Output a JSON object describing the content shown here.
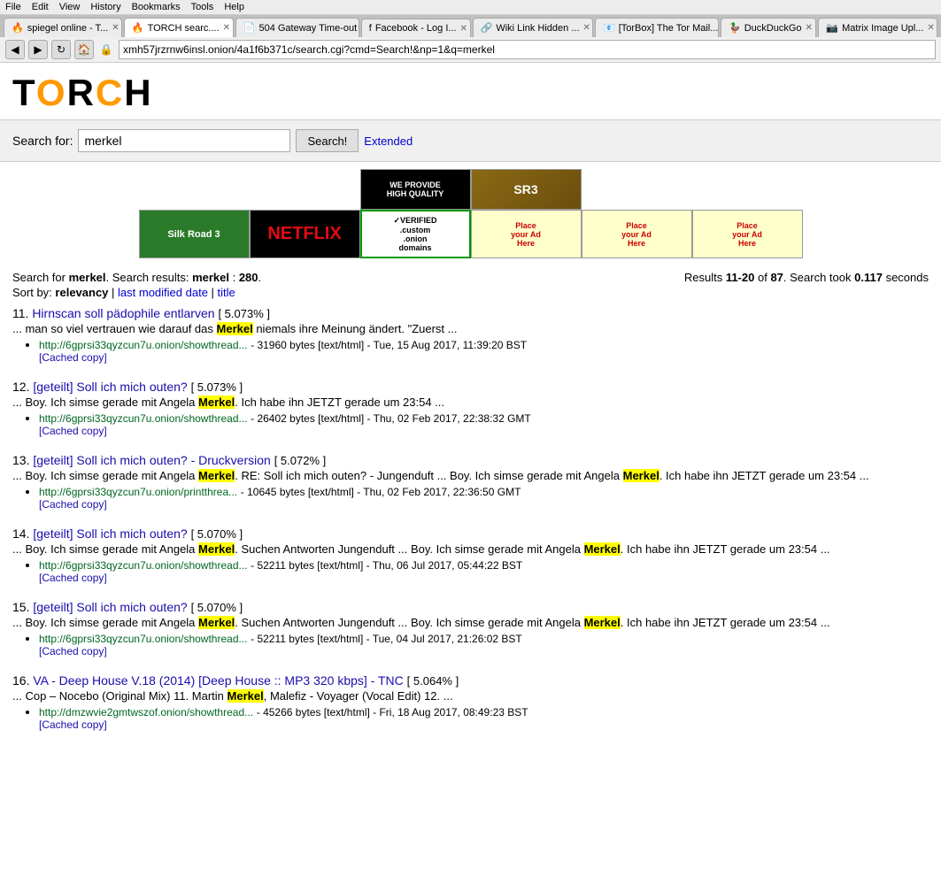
{
  "browser": {
    "menu_items": [
      "File",
      "Edit",
      "View",
      "History",
      "Bookmarks",
      "Tools",
      "Help"
    ],
    "tabs": [
      {
        "label": "spiegel online - T...",
        "active": false,
        "icon": "🔥"
      },
      {
        "label": "TORCH searc....",
        "active": true,
        "icon": "🔥"
      },
      {
        "label": "504 Gateway Time-out",
        "active": false,
        "icon": "📄"
      },
      {
        "label": "Facebook - Log I...",
        "active": false,
        "icon": "f"
      },
      {
        "label": "Wiki Link Hidden ...",
        "active": false,
        "icon": "🔗"
      },
      {
        "label": "[TorBox] The Tor Mail...",
        "active": false,
        "icon": "📧"
      },
      {
        "label": "DuckDuckGo",
        "active": false,
        "icon": "🦆"
      },
      {
        "label": "Matrix Image Upl...",
        "active": false,
        "icon": "📷"
      }
    ],
    "address": "xmh57jrzrnw6insl.onion/4a1f6b371c/search.cgi?cmd=Search!&np=1&q=merkel"
  },
  "bookmarks": [
    {
      "label": "spiegel online - T..."
    },
    {
      "label": "TORCH searc..."
    },
    {
      "label": "504 Gateway Time-out"
    },
    {
      "label": "Facebook - Log I..."
    },
    {
      "label": "Wiki Link Hidden ..."
    },
    {
      "label": "[TorBox] The Tor Mail..."
    },
    {
      "label": "DuckDuckGo"
    },
    {
      "label": "Matrix Image Upl..."
    }
  ],
  "search": {
    "label": "Search for:",
    "query": "merkel",
    "button_label": "Search!",
    "extended_label": "Extended"
  },
  "results_info": {
    "prefix": "Search for",
    "query": "merkel",
    "mid": ". Search results:",
    "query2": "merkel",
    "colon": ":",
    "count": "280",
    "right": "Results",
    "range": "11-20",
    "of": "of",
    "total": "87",
    "time_prefix": ". Search took",
    "time": "0.117",
    "time_suffix": "seconds"
  },
  "sort": {
    "prefix": "Sort by:",
    "relevancy": "relevancy",
    "separator1": "|",
    "last_modified": "last modified date",
    "separator2": "|",
    "title": "title"
  },
  "results": [
    {
      "number": "11.",
      "title": "Hirnscan soll pädophile entlarven",
      "score": "5.073%",
      "snippet": "... man so viel vertrauen wie darauf das",
      "highlight": "Merkel",
      "snippet2": "niemals ihre Meinung ändert. \"Zuerst ...",
      "url": "http://6gprsi33qyzcun7u.onion/showthread...",
      "meta": "- 31960 bytes [text/html] - Tue, 15 Aug 2017, 11:39:20 BST",
      "cached": "[Cached copy]"
    },
    {
      "number": "12.",
      "title": "[geteilt] Soll ich mich outen?",
      "score": "5.073%",
      "snippet": "... Boy. Ich simse gerade mit Angela",
      "highlight": "Merkel",
      "snippet2": ". Ich habe ihn JETZT gerade um 23:54 ...",
      "url": "http://6gprsi33qyzcun7u.onion/showthread...",
      "meta": "- 26402 bytes [text/html] - Thu, 02 Feb 2017, 22:38:32 GMT",
      "cached": "[Cached copy]"
    },
    {
      "number": "13.",
      "title": "[geteilt] Soll ich mich outen? - Druckversion",
      "score": "5.072%",
      "snippet_full": "... Boy. Ich simse gerade mit Angela Merkel. RE: Soll ich mich outen? - Jungenduft ... Boy. Ich simse gerade mit Angela Merkel. Ich habe ihn JETZT gerade um 23:54 ...",
      "snippet": "... Boy. Ich simse gerade mit Angela",
      "highlight": "Merkel",
      "snippet2": ". RE: Soll ich mich outen? - Jungenduft ... Boy. Ich simse gerade mit Angela",
      "highlight2": "Merkel",
      "snippet3": ". Ich habe ihn JETZT gerade um 23:54 ...",
      "url": "http://6gprsi33qyzcun7u.onion/printthrea...",
      "meta": "- 10645 bytes [text/html] - Thu, 02 Feb 2017, 22:36:50 GMT",
      "cached": "[Cached copy]"
    },
    {
      "number": "14.",
      "title": "[geteilt] Soll ich mich outen?",
      "score": "5.070%",
      "snippet": "... Boy. Ich simse gerade mit Angela",
      "highlight": "Merkel",
      "snippet2": ". Suchen Antworten Jungenduft ... Boy. Ich simse gerade mit Angela",
      "highlight2": "Merkel",
      "snippet3": ". Ich habe ihn JETZT gerade um 23:54 ...",
      "url": "http://6gprsi33qyzcun7u.onion/showthread...",
      "meta": "- 52211 bytes [text/html] - Thu, 06 Jul 2017, 05:44:22 BST",
      "cached": "[Cached copy]"
    },
    {
      "number": "15.",
      "title": "[geteilt] Soll ich mich outen?",
      "score": "5.070%",
      "snippet": "... Boy. Ich simse gerade mit Angela",
      "highlight": "Merkel",
      "snippet2": ". Suchen Antworten Jungenduft ... Boy. Ich simse gerade mit Angela",
      "highlight2": "Merkel",
      "snippet3": ". Ich habe ihn JETZT gerade um 23:54 ...",
      "url": "http://6gprsi33qyzcun7u.onion/showthread...",
      "meta": "- 52211 bytes [text/html] - Tue, 04 Jul 2017, 21:26:02 BST",
      "cached": "[Cached copy]"
    },
    {
      "number": "16.",
      "title": "VA - Deep House V.18 (2014) [Deep House :: MP3 320 kbps] - TNC",
      "score": "5.064%",
      "snippet": "... Cop – Nocebo (Original Mix) 11. Martin",
      "highlight": "Merkel",
      "snippet2": ", Malefiz - Voyager (Vocal Edit) 12. ...",
      "url": "http://dmzwvie2gmtwszof.onion/showthread...",
      "meta": "- 45266 bytes [text/html] - Fri, 18 Aug 2017, 08:49:23 BST",
      "cached": "[Cached copy]"
    }
  ]
}
